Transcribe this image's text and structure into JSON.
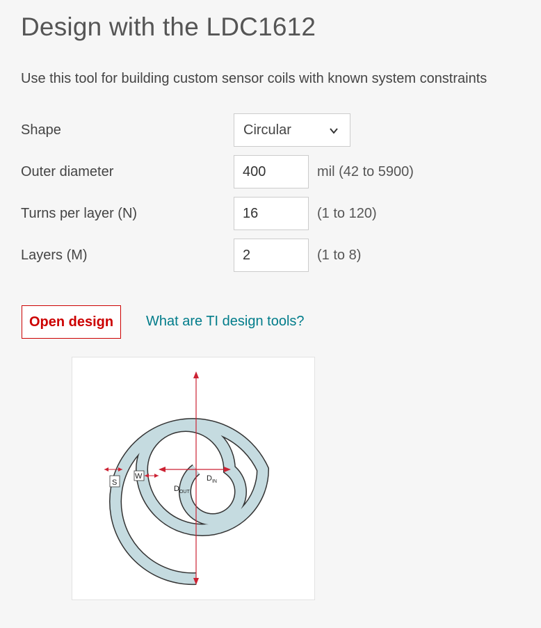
{
  "page": {
    "title": "Design with the LDC1612",
    "subtitle": "Use this tool for building custom sensor coils with known system constraints"
  },
  "form": {
    "shape": {
      "label": "Shape",
      "selected": "Circular"
    },
    "outer_diameter": {
      "label": "Outer diameter",
      "value": "400",
      "unit": "mil (42 to 5900)"
    },
    "turns": {
      "label": "Turns per layer (N)",
      "value": "16",
      "unit": "(1 to 120)"
    },
    "layers": {
      "label": "Layers (M)",
      "value": "2",
      "unit": "(1 to 8)"
    }
  },
  "actions": {
    "open_design": "Open design",
    "info_link": "What are TI design tools?"
  },
  "diagram": {
    "labels": {
      "s": "S",
      "w": "W",
      "dout": "D",
      "dout_sub": "OUT",
      "din": "D",
      "din_sub": "IN"
    }
  },
  "colors": {
    "accent_red": "#cc0000",
    "link_teal": "#007c8a",
    "coil_fill": "#c5dbe0",
    "dimension_red": "#cc2233"
  },
  "icons": {
    "select": "chevron-down-icon"
  }
}
